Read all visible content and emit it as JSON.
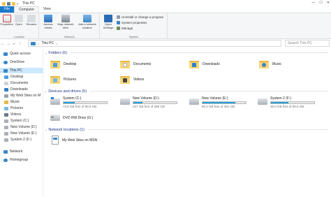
{
  "window": {
    "title": "This PC",
    "minimize": "—",
    "maximize": "☐",
    "close": "✕"
  },
  "tabs": [
    {
      "label": "File"
    },
    {
      "label": "Computer"
    },
    {
      "label": "View"
    }
  ],
  "ribbon": {
    "location": {
      "name": "Location",
      "properties": "Properties",
      "open": "Open",
      "rename": "Rename"
    },
    "network": {
      "name": "Network",
      "access_media": "Access media",
      "map_drive": "Map network drive",
      "add_location": "Add a network location"
    },
    "system": {
      "name": "System",
      "open_settings": "Open Settings",
      "uninstall": "Uninstall or change a program",
      "system_properties": "System properties",
      "manage": "Manage"
    }
  },
  "address": {
    "path_root": "This PC",
    "separator": ">",
    "search_placeholder": "Search This PC"
  },
  "sidebar": {
    "items": [
      {
        "label": "Quick access"
      },
      {
        "label": "OneDrive"
      },
      {
        "label": "This PC"
      },
      {
        "label": "Desktop"
      },
      {
        "label": "Documents"
      },
      {
        "label": "Downloads"
      },
      {
        "label": "My Web Sites on M"
      },
      {
        "label": "Music"
      },
      {
        "label": "Pictures"
      },
      {
        "label": "Videos"
      },
      {
        "label": "System (C:)"
      },
      {
        "label": "New Volume (D:)"
      },
      {
        "label": "New Volume (E:)"
      },
      {
        "label": "System 2 (F:)"
      },
      {
        "label": "Network"
      },
      {
        "label": "Homegroup"
      }
    ]
  },
  "folders": {
    "header": "Folders (6)",
    "items": [
      {
        "label": "Desktop"
      },
      {
        "label": "Documents"
      },
      {
        "label": "Downloads"
      },
      {
        "label": "Music"
      },
      {
        "label": "Pictures"
      },
      {
        "label": "Videos"
      }
    ]
  },
  "devices": {
    "header": "Devices and drives (5)",
    "drives": [
      {
        "label": "System (C:)",
        "free": "73.8 GB free of 99.9 GB",
        "used_fraction": 0.26
      },
      {
        "label": "New Volume (D:)",
        "free": "227 GB free of 288 GB",
        "used_fraction": 0.21
      },
      {
        "label": "New Volume (E:)",
        "free": "90.3 GB free of 361 GB",
        "used_fraction": 0.75
      },
      {
        "label": "System 2 (F:)",
        "free": "35.0 GB free of 59.6 GB",
        "used_fraction": 0.41
      }
    ],
    "dvd": {
      "label": "DVD RW Drive (G:)"
    }
  },
  "network_locations": {
    "header": "Network locations (1)",
    "items": [
      {
        "label": "My Web Sites on MSN"
      }
    ]
  },
  "colors": {
    "accent": "#1979ca",
    "folder": "#f8d775",
    "bar_fill": "#26a0da",
    "selection": "#cce8ff"
  }
}
